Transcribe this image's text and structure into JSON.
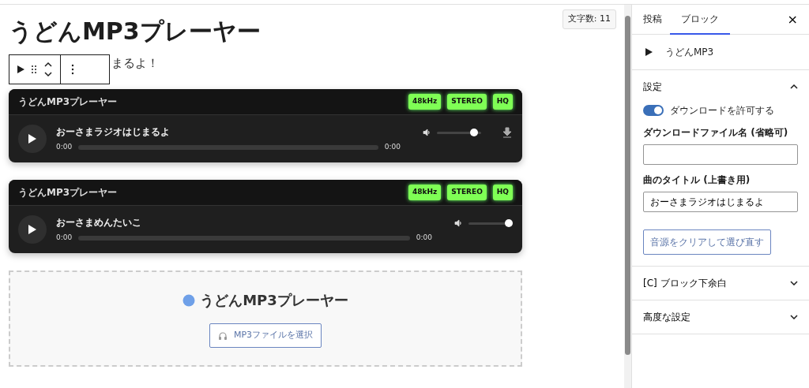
{
  "editor": {
    "title": "うどんMP3プレーヤー",
    "word_count": "文字数: 11",
    "paragraph": "まるよ！"
  },
  "players": [
    {
      "header": "うどんMP3プレーヤー",
      "badges": [
        "48kHz",
        "STEREO",
        "HQ"
      ],
      "track": "おーさまラジオはじまるよ",
      "current": "0:00",
      "duration": "0:00",
      "volume": {
        "level": 0.92
      },
      "download": true
    },
    {
      "header": "うどんMP3プレーヤー",
      "badges": [
        "48kHz",
        "STEREO",
        "HQ"
      ],
      "track": "おーさまめんたいこ",
      "current": "0:00",
      "duration": "0:00",
      "volume": {
        "level": 1
      },
      "download": false
    }
  ],
  "placeholder_block": {
    "title": "うどんMP3プレーヤー",
    "button": "MP3ファイルを選択"
  },
  "sidebar": {
    "tabs": [
      {
        "label": "投稿",
        "selected": false
      },
      {
        "label": "ブロック",
        "selected": true
      }
    ],
    "close": "×",
    "block_name": "うどんMP3",
    "panels": [
      {
        "title": "設定",
        "expanded": true,
        "toggle": {
          "label": "ダウンロードを許可する",
          "on": true
        },
        "fields": [
          {
            "label": "ダウンロードファイル名 (省略可)"
          },
          {
            "label": "曲のタイトル (上書き用)",
            "value": "おーさまラジオはじまるよ"
          }
        ],
        "button": "音源をクリアして選び直す"
      },
      {
        "title": "[C] ブロック下余白",
        "expanded": false
      },
      {
        "title": "高度な設定",
        "expanded": false
      }
    ]
  }
}
